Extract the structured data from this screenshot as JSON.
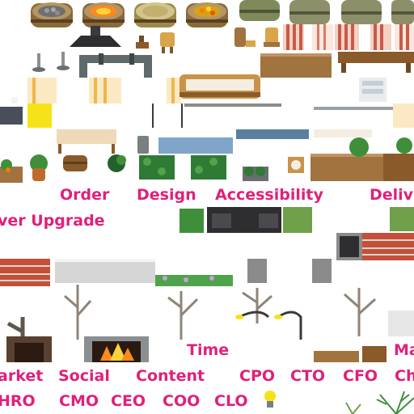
{
  "tileset": {
    "labels": {
      "order": "Order",
      "design": "Design",
      "accessibility": "Accessibility",
      "deliv": "Deliv",
      "ver_upgrade": "ver Upgrade",
      "time": "Time",
      "ma": "Ma",
      "arket": "arket",
      "social": "Social",
      "content": "Content",
      "cpo": "CPO",
      "cto": "CTO",
      "cfo": "CFO",
      "ch": "Ch",
      "hro": "HRO",
      "cmo": "CMO",
      "ceo": "CEO",
      "coo": "COO",
      "clo": "CLO"
    },
    "colors": {
      "label_text": "#e0207a",
      "wood": "#a0733f",
      "wood_dark": "#6e4a25",
      "brick": "#c2503a",
      "leaf": "#3f8f3a",
      "leaf_dark": "#23612a",
      "metal": "#7a7f80",
      "glass_blue": "#7fa6c8",
      "sticky_yellow": "#f7e21a",
      "fire": "#ff8a1c"
    }
  }
}
